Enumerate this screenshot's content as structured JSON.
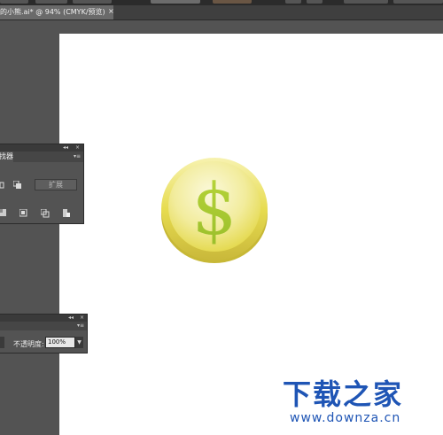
{
  "document": {
    "tab_title": "的小熊.ai* @ 94% (CMYK/预览)",
    "close_glyph": "×",
    "artboard_color": "#ffffff"
  },
  "pathfinder_panel": {
    "tab_label": "径查找器",
    "collapse_glyph": "◂◂",
    "close_glyph": "×",
    "menu_glyph": "▾≡",
    "expand_label": "扩展"
  },
  "transparency_panel": {
    "collapse_glyph": "◂◂",
    "close_glyph": "×",
    "menu_glyph": "▾≡",
    "opacity_label": "不透明度:",
    "opacity_value": "100%",
    "dropdown_glyph": "▼"
  },
  "coin": {
    "symbol": "$",
    "colors": {
      "face": "#f2ec9c",
      "rim": "#e2d84a",
      "edge": "#c7b836",
      "symbol": "#a6c92c"
    }
  },
  "watermark": {
    "name": "下载之家",
    "url": "www.downza.cn",
    "color": "#1f55b5"
  }
}
